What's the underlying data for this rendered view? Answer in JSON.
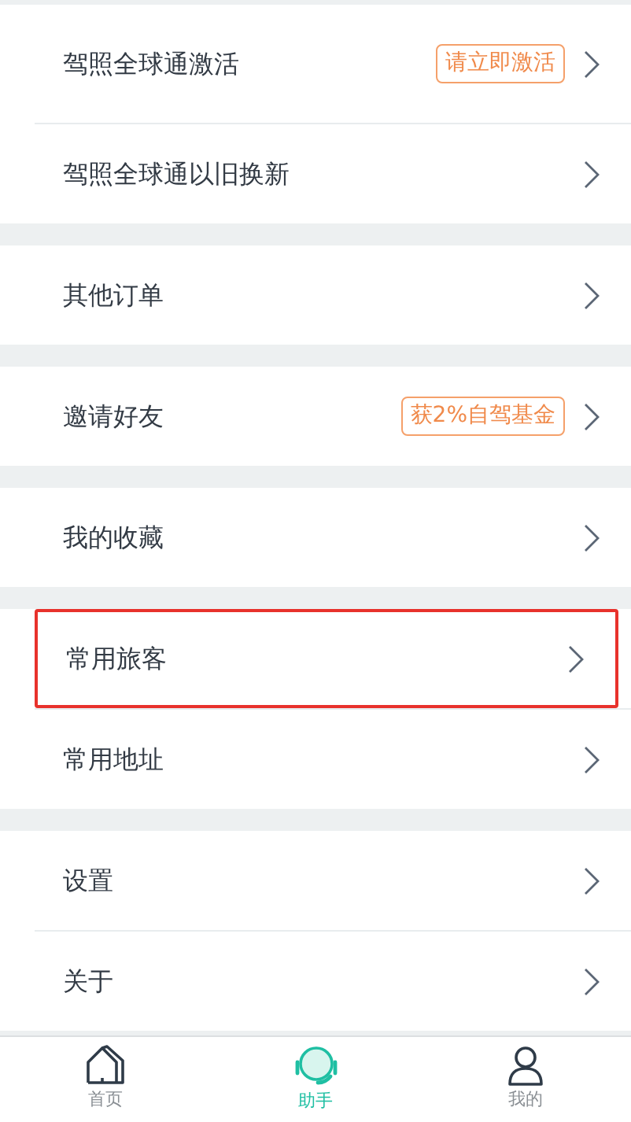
{
  "groups": [
    {
      "items": [
        {
          "label": "驾照全球通激活",
          "badge": "请立即激活",
          "highlighted": false
        },
        {
          "label": "驾照全球通以旧换新",
          "highlighted": false
        }
      ]
    },
    {
      "items": [
        {
          "label": "其他订单",
          "highlighted": false
        }
      ]
    },
    {
      "items": [
        {
          "label": "邀请好友",
          "badge": "获2%自驾基金",
          "highlighted": false
        }
      ]
    },
    {
      "items": [
        {
          "label": "我的收藏",
          "highlighted": false
        }
      ]
    },
    {
      "items": [
        {
          "label": "常用旅客",
          "highlighted": true
        },
        {
          "label": "常用地址",
          "highlighted": false
        }
      ]
    },
    {
      "items": [
        {
          "label": "设置",
          "highlighted": false
        },
        {
          "label": "关于",
          "highlighted": false
        }
      ]
    }
  ],
  "tab_bar": [
    {
      "kind": "home",
      "label": "首页",
      "selected": false
    },
    {
      "kind": "assistant",
      "label": "助手",
      "selected": true
    },
    {
      "kind": "profile",
      "label": "我的",
      "selected": false
    }
  ]
}
